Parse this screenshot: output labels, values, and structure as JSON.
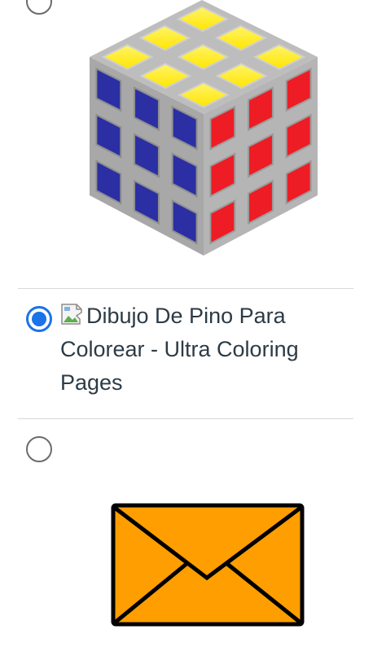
{
  "options": [
    {
      "id": "rubiks-cube",
      "selected": false,
      "image_icon": "rubiks-cube-image"
    },
    {
      "id": "pine-drawing",
      "selected": true,
      "label": "Dibujo De Pino Para Colorear - Ultra Coloring Pages",
      "image_icon": "broken-image-icon"
    },
    {
      "id": "envelope",
      "selected": false,
      "image_icon": "envelope-image"
    }
  ],
  "colors": {
    "accent": "#1a73e8",
    "cube_top": "#ffee00",
    "cube_left": "#2b2fa3",
    "cube_right": "#ee1c24",
    "envelope": "#ff9e00"
  }
}
